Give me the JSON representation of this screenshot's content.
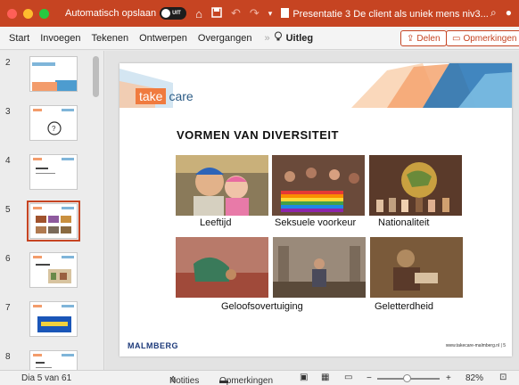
{
  "titlebar": {
    "autosave_label": "Automatisch opslaan",
    "autosave_state": "UIT",
    "document_title": "Presentatie 3 De client als uniek mens niv3...",
    "icons": [
      "home-icon",
      "save-icon",
      "undo-icon",
      "redo-icon",
      "customize-icon",
      "search-icon",
      "account-icon"
    ]
  },
  "ribbon": {
    "tabs": [
      "Start",
      "Invoegen",
      "Tekenen",
      "Ontwerpen",
      "Overgangen"
    ],
    "more_glyph": "»",
    "tell_me": "Uitleg",
    "share": "Delen",
    "comments": "Opmerkingen"
  },
  "thumbnails": [
    {
      "number": "2"
    },
    {
      "number": "3"
    },
    {
      "number": "4"
    },
    {
      "number": "5",
      "selected": true
    },
    {
      "number": "6"
    },
    {
      "number": "7"
    },
    {
      "number": "8"
    }
  ],
  "slide": {
    "logo_take": "take",
    "logo_care": "care",
    "title": "VORMEN VAN DIVERSITEIT",
    "captions": {
      "leeftijd": "Leeftijd",
      "seksuele": "Seksuele voorkeur",
      "nationaliteit": "Nationaliteit",
      "geloof": "Geloofsovertuiging",
      "geletterdheid": "Geletterdheid"
    },
    "footer_logo": "MALMBERG",
    "footer_url": "www.takecare-malmberg.nl | 5"
  },
  "status": {
    "slide_counter": "Dia 5 van 61",
    "notes": "Notities",
    "comments": "Opmerkingen",
    "zoom_minus": "−",
    "zoom_plus": "+",
    "zoom_level": "82%"
  },
  "colors": {
    "accent": "#c64422",
    "logo_orange": "#f07b3f",
    "logo_blue": "#2c5c86",
    "malmberg_blue": "#1d3a7a"
  }
}
